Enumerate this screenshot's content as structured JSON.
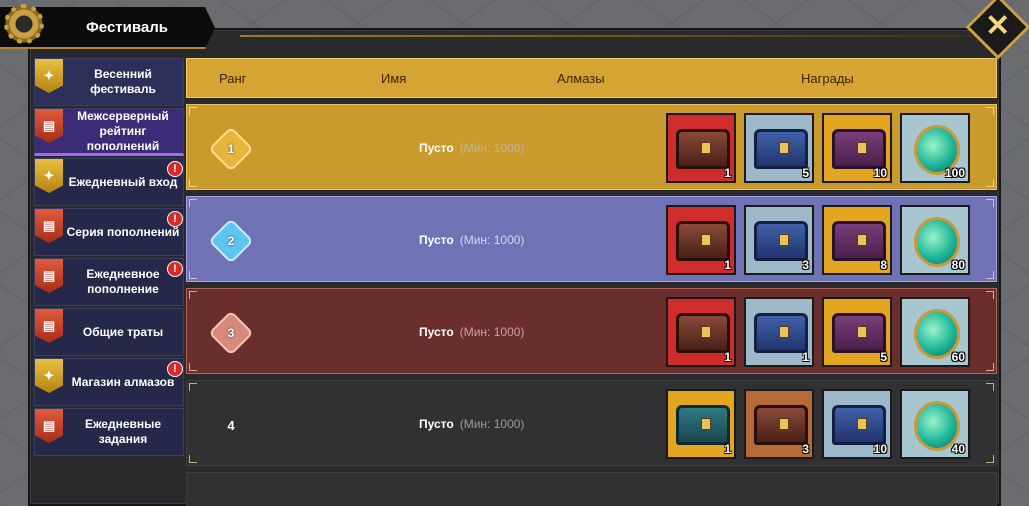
{
  "window": {
    "title": "Фестиваль"
  },
  "sidebar": {
    "items": [
      {
        "label": "Весенний фестиваль",
        "icon": "gold",
        "badge": ""
      },
      {
        "label": "Межсерверный рейтинг пополнений",
        "icon": "red",
        "badge": ""
      },
      {
        "label": "Ежедневный вход",
        "icon": "gold",
        "badge": "!"
      },
      {
        "label": "Серия пополнений",
        "icon": "red",
        "badge": "!"
      },
      {
        "label": "Ежедневное пополнение",
        "icon": "red",
        "badge": "!"
      },
      {
        "label": "Общие траты",
        "icon": "red",
        "badge": ""
      },
      {
        "label": "Магазин алмазов",
        "icon": "gold",
        "badge": "!"
      },
      {
        "label": "Ежедневные задания",
        "icon": "red",
        "badge": ""
      }
    ]
  },
  "table": {
    "columns": [
      "Ранг",
      "Имя",
      "Алмазы",
      "Награды"
    ],
    "rows": [
      {
        "rank": "1",
        "name": "Пусто",
        "min": "(Мин: 1000)",
        "rewards": [
          {
            "qty": "1",
            "bg": "red",
            "kind": "chest",
            "chest": "red"
          },
          {
            "qty": "5",
            "bg": "blue",
            "kind": "chest",
            "chest": "blue"
          },
          {
            "qty": "10",
            "bg": "gold",
            "kind": "chest",
            "chest": "purple"
          },
          {
            "qty": "100",
            "bg": "teal",
            "kind": "potion",
            "chest": ""
          }
        ]
      },
      {
        "rank": "2",
        "name": "Пусто",
        "min": "(Мин: 1000)",
        "rewards": [
          {
            "qty": "1",
            "bg": "red",
            "kind": "chest",
            "chest": "red"
          },
          {
            "qty": "3",
            "bg": "blue",
            "kind": "chest",
            "chest": "blue"
          },
          {
            "qty": "8",
            "bg": "gold",
            "kind": "chest",
            "chest": "purple"
          },
          {
            "qty": "80",
            "bg": "teal",
            "kind": "potion",
            "chest": ""
          }
        ]
      },
      {
        "rank": "3",
        "name": "Пусто",
        "min": "(Мин: 1000)",
        "rewards": [
          {
            "qty": "1",
            "bg": "red",
            "kind": "chest",
            "chest": "red"
          },
          {
            "qty": "1",
            "bg": "blue",
            "kind": "chest",
            "chest": "blue"
          },
          {
            "qty": "5",
            "bg": "gold",
            "kind": "chest",
            "chest": "purple"
          },
          {
            "qty": "60",
            "bg": "teal",
            "kind": "potion",
            "chest": ""
          }
        ]
      },
      {
        "rank": "4",
        "name": "Пусто",
        "min": "(Мин: 1000)",
        "rewards": [
          {
            "qty": "1",
            "bg": "gold",
            "kind": "chest",
            "chest": "teal"
          },
          {
            "qty": "3",
            "bg": "orange",
            "kind": "chest",
            "chest": "red"
          },
          {
            "qty": "10",
            "bg": "blue",
            "kind": "chest",
            "chest": "blue"
          },
          {
            "qty": "40",
            "bg": "teal",
            "kind": "potion",
            "chest": ""
          }
        ]
      }
    ]
  }
}
